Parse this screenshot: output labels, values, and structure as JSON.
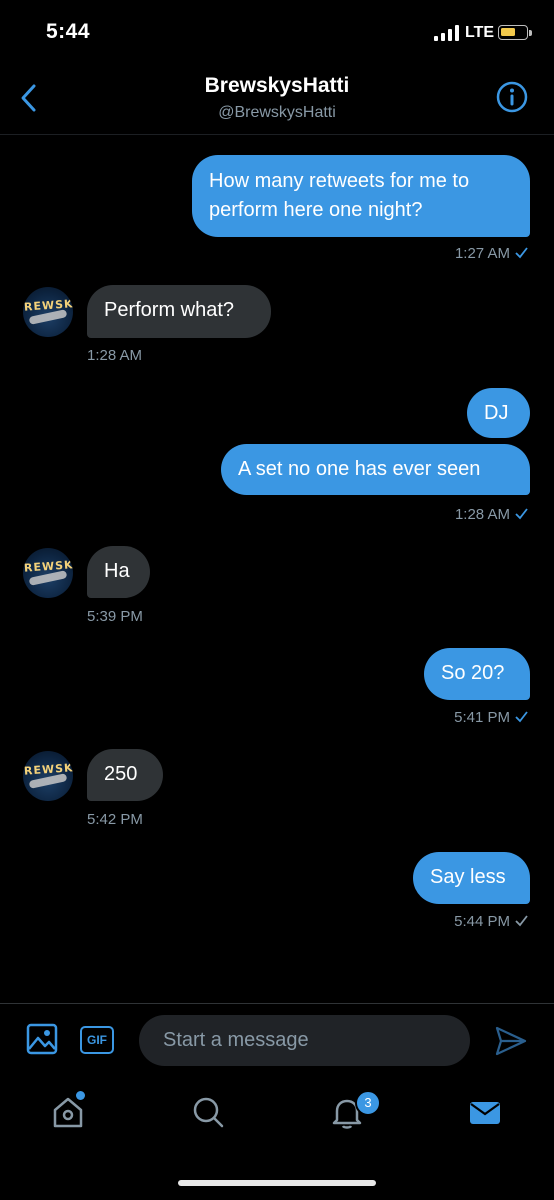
{
  "status_bar": {
    "time": "5:44",
    "network": "LTE",
    "battery_color": "#f2c94c"
  },
  "header": {
    "name": "BrewskysHatti",
    "handle": "@BrewskysHatti",
    "back_icon": "chevron-left-icon",
    "info_icon": "info-icon"
  },
  "avatar": {
    "text": "REWSK"
  },
  "messages": [
    {
      "direction": "out",
      "lines": [
        "How many retweets for me to",
        "perform here one night?"
      ],
      "time": "1:27 AM",
      "read": true
    },
    {
      "direction": "in",
      "text": "Perform what?",
      "time": "1:28 AM"
    },
    {
      "direction": "out",
      "text": "DJ"
    },
    {
      "direction": "out",
      "text": "A set no one has ever seen",
      "time": "1:28 AM",
      "read": true
    },
    {
      "direction": "in",
      "text": "Ha",
      "time": "5:39 PM"
    },
    {
      "direction": "out",
      "text": "So 20?",
      "time": "5:41 PM",
      "read": true
    },
    {
      "direction": "in",
      "text": "250",
      "time": "5:42 PM"
    },
    {
      "direction": "out",
      "text": "Say less",
      "time": "5:44 PM",
      "read": false
    }
  ],
  "composer": {
    "placeholder": "Start a message",
    "gif_label": "GIF",
    "media_icon": "image-icon",
    "send_icon": "send-icon"
  },
  "tab_bar": {
    "items": [
      "home",
      "search",
      "notifications",
      "messages"
    ],
    "notifications_badge": "3"
  },
  "colors": {
    "accent": "#3b97e3",
    "incoming_bubble": "#2f3336",
    "background": "#000000",
    "muted_text": "#8899a6"
  }
}
